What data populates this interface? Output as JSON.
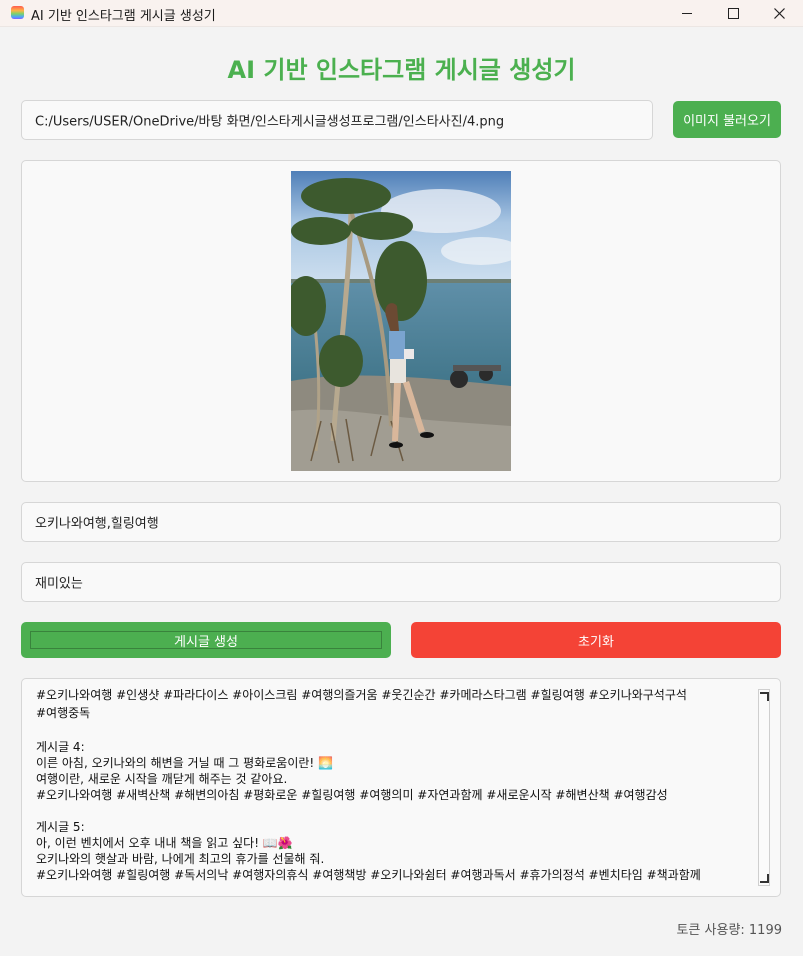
{
  "window": {
    "title": "AI 기반 인스타그램 게시글 생성기"
  },
  "app": {
    "heading": "AI 기반 인스타그램 게시글 생성기",
    "accent_color": "#4caf50",
    "danger_color": "#f44336"
  },
  "image_path": {
    "value": "C:/Users/USER/OneDrive/바탕 화면/인스타게시글생성프로그램/인스타사진/4.png"
  },
  "buttons": {
    "load_image": "이미지 불러오기",
    "generate": "게시글 생성",
    "reset": "초기화"
  },
  "keywords": {
    "value": "오키나와여행,힐링여행"
  },
  "tone": {
    "value": "재미있는"
  },
  "output": {
    "lines": [
      "#오키나와여행 #인생샷 #파라다이스 #아이스크림 #여행의즐거움 #웃긴순간 #카메라스타그램 #힐링여행 #오키나와구석구석",
      "#여행중독",
      "",
      "게시글 4:",
      "이른 아침, 오키나와의 해변을 거닐 때 그 평화로움이란! 🌅",
      "여행이란, 새로운 시작을 깨닫게 해주는 것 같아요.",
      "#오키나와여행 #새벽산책 #해변의아침 #평화로운 #힐링여행 #여행의미 #자연과함께 #새로운시작 #해변산책 #여행감성",
      "",
      "게시글 5:",
      "아, 이런 벤치에서 오후 내내 책을 읽고 싶다! 📖🌺",
      "오키나와의 햇살과 바람, 나에게 최고의 휴가를 선물해 줘.",
      "#오키나와여행 #힐링여행 #독서의낙 #여행자의휴식 #여행책방 #오키나와쉼터 #여행과독서 #휴가의정석 #벤치타임 #책과함께"
    ]
  },
  "status": {
    "token_usage": "토큰 사용량: 1199"
  }
}
